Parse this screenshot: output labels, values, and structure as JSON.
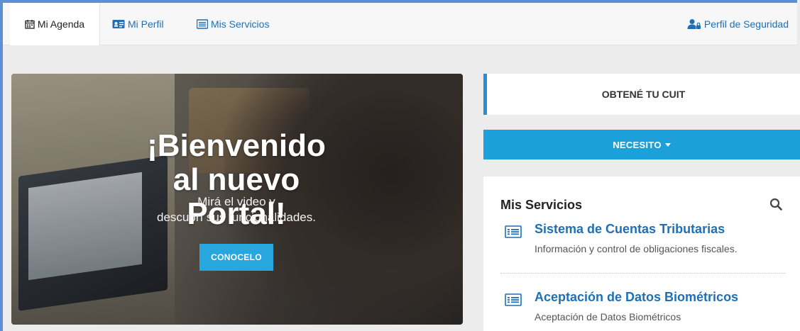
{
  "nav": {
    "tabs": [
      {
        "label": "Mi Agenda",
        "icon": "calendar-icon",
        "active": true
      },
      {
        "label": "Mi Perfil",
        "icon": "id-card-icon",
        "active": false
      },
      {
        "label": "Mis Servicios",
        "icon": "list-icon",
        "active": false
      }
    ],
    "security": {
      "label": "Perfil de Seguridad",
      "icon": "user-lock-icon"
    }
  },
  "hero": {
    "title": "¡Bienvenido al nuevo Portal!",
    "subtitle_line1": "Mirá el video y",
    "subtitle_line2": "descubrí sus funcionalidades.",
    "button": "CONOCELO"
  },
  "cuit": {
    "label": "OBTENÉ TU CUIT"
  },
  "necesito": {
    "label": "NECESITO"
  },
  "servicios": {
    "title": "Mis Servicios",
    "items": [
      {
        "title": "Sistema de Cuentas Tributarias",
        "description": "Información y control de obligaciones fiscales."
      },
      {
        "title": "Aceptación de Datos Biométricos",
        "description": "Aceptación de Datos Biométricos"
      }
    ]
  },
  "colors": {
    "accent": "#1ba0d9",
    "link": "#1e6fb5",
    "frame": "#5b8fd6"
  }
}
